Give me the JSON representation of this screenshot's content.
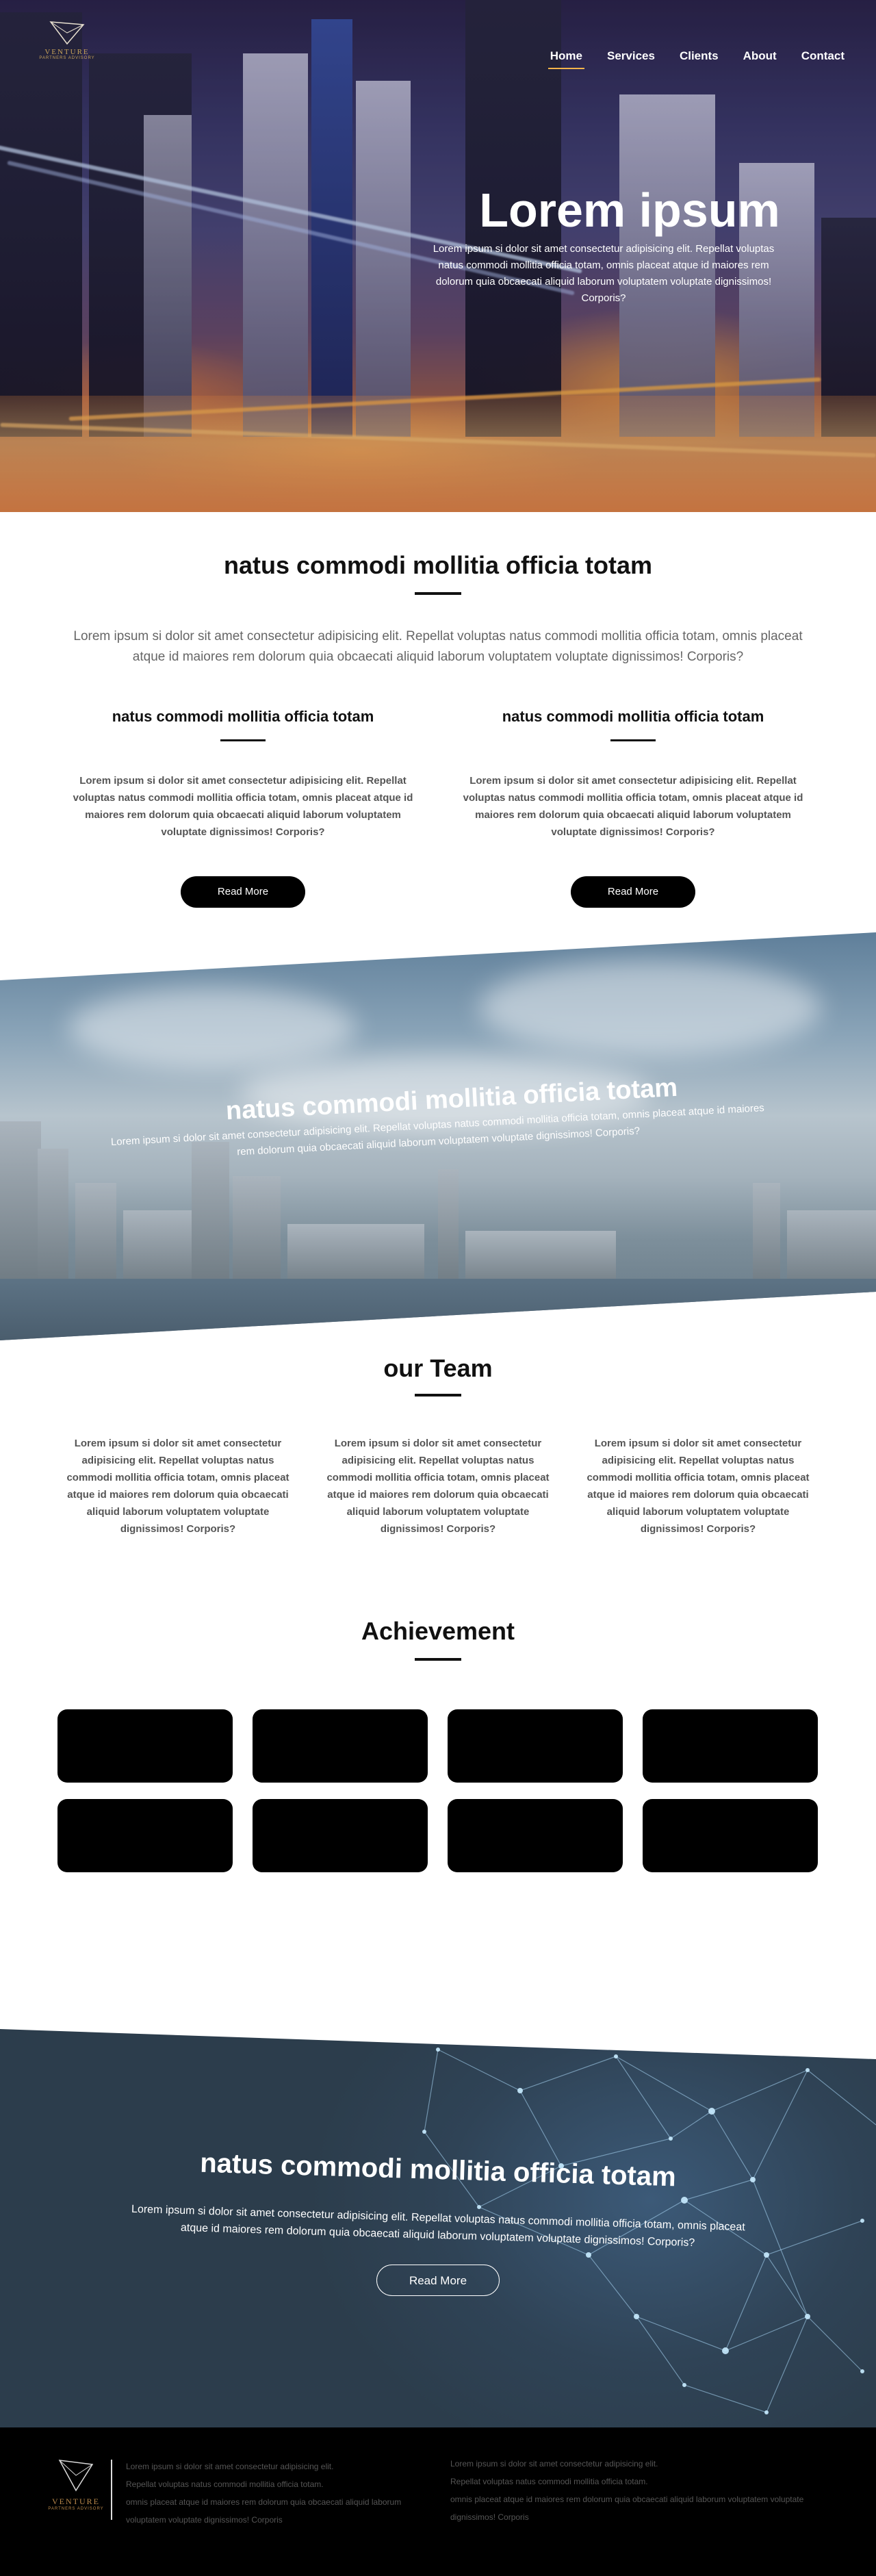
{
  "brand": {
    "name": "VENTURE",
    "tagline": "PARTNERS ADVISORY"
  },
  "nav": {
    "items": [
      "Home",
      "Services",
      "Clients",
      "About",
      "Contact"
    ],
    "active": "Home"
  },
  "hero": {
    "title": "Lorem ipsum",
    "text": "Lorem ipsum si dolor sit amet consectetur adipisicing elit. Repellat voluptas natus commodi mollitia officia totam, omnis placeat atque id maiores rem dolorum quia obcaecati aliquid laborum voluptatem voluptate dignissimos! Corporis?"
  },
  "intro": {
    "title": "natus commodi mollitia officia totam",
    "lead": "Lorem ipsum si dolor sit amet consectetur adipisicing elit. Repellat voluptas natus commodi mollitia officia totam, omnis placeat atque id maiores rem dolorum quia obcaecati aliquid laborum voluptatem voluptate dignissimos! Corporis?",
    "columns": [
      {
        "title": "natus commodi mollitia officia totam",
        "text": "Lorem ipsum si dolor sit amet consectetur adipisicing elit. Repellat voluptas natus commodi mollitia officia totam, omnis placeat atque id maiores rem dolorum quia obcaecati aliquid laborum voluptatem voluptate dignissimos! Corporis?",
        "button": "Read More"
      },
      {
        "title": "natus commodi mollitia officia totam",
        "text": "Lorem ipsum si dolor sit amet consectetur adipisicing elit. Repellat voluptas natus commodi mollitia officia totam, omnis placeat atque id maiores rem dolorum quia obcaecati aliquid laborum voluptatem voluptate dignissimos! Corporis?",
        "button": "Read More"
      }
    ]
  },
  "city_band": {
    "title": "natus commodi mollitia officia totam",
    "text": "Lorem ipsum si dolor sit amet consectetur adipisicing elit. Repellat voluptas natus commodi mollitia officia totam, omnis placeat atque id maiores rem dolorum quia obcaecati aliquid laborum voluptatem voluptate dignissimos! Corporis?"
  },
  "team": {
    "title": "our Team",
    "members": [
      {
        "text": "Lorem ipsum si dolor sit amet consectetur adipisicing elit. Repellat voluptas natus commodi mollitia officia totam, omnis placeat atque id maiores rem dolorum quia obcaecati aliquid laborum voluptatem voluptate dignissimos! Corporis?"
      },
      {
        "text": "Lorem ipsum si dolor sit amet consectetur adipisicing elit. Repellat voluptas natus commodi mollitia officia totam, omnis placeat atque id maiores rem dolorum quia obcaecati aliquid laborum voluptatem voluptate dignissimos! Corporis?"
      },
      {
        "text": "Lorem ipsum si dolor sit amet consectetur adipisicing elit. Repellat voluptas natus commodi mollitia officia totam, omnis placeat atque id maiores rem dolorum quia obcaecati aliquid laborum voluptatem voluptate dignissimos! Corporis?"
      }
    ]
  },
  "achievement": {
    "title": "Achievement"
  },
  "network_band": {
    "title": "natus commodi mollitia officia totam",
    "text": "Lorem ipsum si dolor sit amet consectetur adipisicing elit. Repellat voluptas natus commodi mollitia officia totam, omnis placeat atque id maiores rem dolorum quia obcaecati aliquid laborum voluptatem voluptate dignissimos! Corporis?",
    "button": "Read More"
  },
  "footer": {
    "col1": [
      "Lorem ipsum si dolor sit amet consectetur adipisicing elit.",
      "Repellat voluptas natus commodi mollitia officia totam.",
      "omnis placeat atque id maiores rem dolorum quia obcaecati aliquid laborum",
      "voluptatem voluptate dignissimos! Corporis"
    ],
    "col2": [
      "Lorem ipsum si dolor sit amet consectetur adipisicing elit.",
      "Repellat voluptas natus commodi mollitia officia totam.",
      "omnis placeat atque id maiores rem dolorum quia obcaecati aliquid laborum voluptatem voluptate",
      "dignissimos! Corporis"
    ]
  },
  "colors": {
    "nav_active_underline": "#f4b44a",
    "brand_gold": "#c8a35a",
    "button_bg": "#000000",
    "footer_bg": "#000000"
  }
}
